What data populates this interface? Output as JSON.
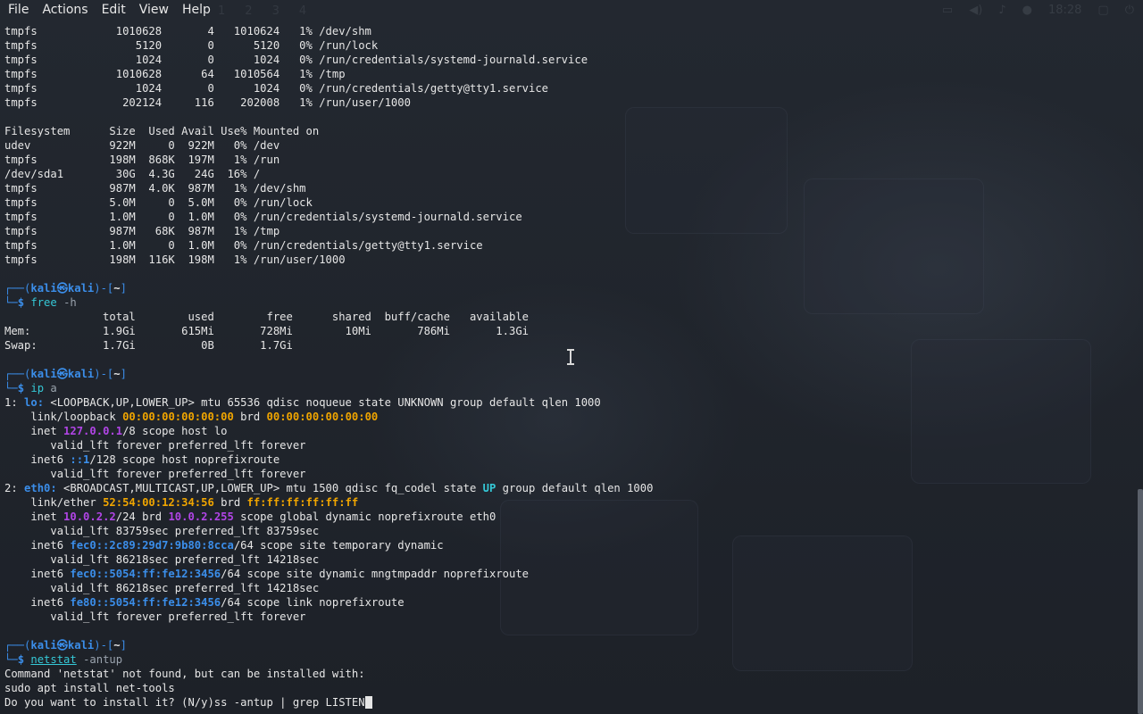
{
  "menubar": {
    "items": [
      "File",
      "Actions",
      "Edit",
      "View",
      "Help"
    ]
  },
  "panel": {
    "workspaces": [
      "1",
      "2",
      "3",
      "4"
    ],
    "clock": "18:28"
  },
  "lines": [
    [
      {
        "t": "tmpfs            1010628       4   1010624   1% /dev/shm"
      }
    ],
    [
      {
        "t": "tmpfs               5120       0      5120   0% /run/lock"
      }
    ],
    [
      {
        "t": "tmpfs               1024       0      1024   0% /run/credentials/systemd-journald.service"
      }
    ],
    [
      {
        "t": "tmpfs            1010628      64   1010564   1% /tmp"
      }
    ],
    [
      {
        "t": "tmpfs               1024       0      1024   0% /run/credentials/getty@tty1.service"
      }
    ],
    [
      {
        "t": "tmpfs             202124     116    202008   1% /run/user/1000"
      }
    ],
    [
      {
        "t": ""
      }
    ],
    [
      {
        "t": "Filesystem      Size  Used Avail Use% Mounted on"
      }
    ],
    [
      {
        "t": "udev            922M     0  922M   0% /dev"
      }
    ],
    [
      {
        "t": "tmpfs           198M  868K  197M   1% /run"
      }
    ],
    [
      {
        "t": "/dev/sda1        30G  4.3G   24G  16% /"
      }
    ],
    [
      {
        "t": "tmpfs           987M  4.0K  987M   1% /dev/shm"
      }
    ],
    [
      {
        "t": "tmpfs           5.0M     0  5.0M   0% /run/lock"
      }
    ],
    [
      {
        "t": "tmpfs           1.0M     0  1.0M   0% /run/credentials/systemd-journald.service"
      }
    ],
    [
      {
        "t": "tmpfs           987M   68K  987M   1% /tmp"
      }
    ],
    [
      {
        "t": "tmpfs           1.0M     0  1.0M   0% /run/credentials/getty@tty1.service"
      }
    ],
    [
      {
        "t": "tmpfs           198M  116K  198M   1% /run/user/1000"
      }
    ],
    [
      {
        "t": ""
      }
    ],
    [
      {
        "t": "┌──(",
        "c": "prompt-frame"
      },
      {
        "t": "kali㉿kali",
        "c": "prompt-user"
      },
      {
        "t": ")-[",
        "c": "prompt-frame"
      },
      {
        "t": "~",
        "c": "prompt-dir"
      },
      {
        "t": "]",
        "c": "prompt-frame"
      }
    ],
    [
      {
        "t": "└─",
        "c": "prompt-frame"
      },
      {
        "t": "$ ",
        "c": "prompt-user"
      },
      {
        "t": "free",
        "c": "cmd"
      },
      {
        "t": " -h",
        "c": "cmd-args"
      }
    ],
    [
      {
        "t": "               total        used        free      shared  buff/cache   available"
      }
    ],
    [
      {
        "t": "Mem:           1.9Gi       615Mi       728Mi        10Mi       786Mi       1.3Gi"
      }
    ],
    [
      {
        "t": "Swap:          1.7Gi          0B       1.7Gi"
      }
    ],
    [
      {
        "t": ""
      }
    ],
    [
      {
        "t": "┌──(",
        "c": "prompt-frame"
      },
      {
        "t": "kali㉿kali",
        "c": "prompt-user"
      },
      {
        "t": ")-[",
        "c": "prompt-frame"
      },
      {
        "t": "~",
        "c": "prompt-dir"
      },
      {
        "t": "]",
        "c": "prompt-frame"
      }
    ],
    [
      {
        "t": "└─",
        "c": "prompt-frame"
      },
      {
        "t": "$ ",
        "c": "prompt-user"
      },
      {
        "t": "ip",
        "c": "cmd"
      },
      {
        "t": " a",
        "c": "cmd-args"
      }
    ],
    [
      {
        "t": "1: "
      },
      {
        "t": "lo:",
        "c": "iface"
      },
      {
        "t": " <LOOPBACK,UP,LOWER_UP> mtu 65536 qdisc noqueue state UNKNOWN group default qlen 1000"
      }
    ],
    [
      {
        "t": "    link/loopback "
      },
      {
        "t": "00:00:00:00:00:00",
        "c": "mac"
      },
      {
        "t": " brd "
      },
      {
        "t": "00:00:00:00:00:00",
        "c": "mac"
      }
    ],
    [
      {
        "t": "    inet "
      },
      {
        "t": "127.0.0.1",
        "c": "ipv4"
      },
      {
        "t": "/8 scope host lo"
      }
    ],
    [
      {
        "t": "       valid_lft forever preferred_lft forever"
      }
    ],
    [
      {
        "t": "    inet6 "
      },
      {
        "t": "::1",
        "c": "ipv6"
      },
      {
        "t": "/128 scope host noprefixroute"
      }
    ],
    [
      {
        "t": "       valid_lft forever preferred_lft forever"
      }
    ],
    [
      {
        "t": "2: "
      },
      {
        "t": "eth0:",
        "c": "iface"
      },
      {
        "t": " <BROADCAST,MULTICAST,UP,LOWER_UP> mtu 1500 qdisc fq_codel state "
      },
      {
        "t": "UP",
        "c": "up"
      },
      {
        "t": " group default qlen 1000"
      }
    ],
    [
      {
        "t": "    link/ether "
      },
      {
        "t": "52:54:00:12:34:56",
        "c": "mac"
      },
      {
        "t": " brd "
      },
      {
        "t": "ff:ff:ff:ff:ff:ff",
        "c": "mac"
      }
    ],
    [
      {
        "t": "    inet "
      },
      {
        "t": "10.0.2.2",
        "c": "ipv4"
      },
      {
        "t": "/24 brd "
      },
      {
        "t": "10.0.2.255",
        "c": "ipv4"
      },
      {
        "t": " scope global dynamic noprefixroute eth0"
      }
    ],
    [
      {
        "t": "       valid_lft 83759sec preferred_lft 83759sec"
      }
    ],
    [
      {
        "t": "    inet6 "
      },
      {
        "t": "fec0::2c89:29d7:9b80:8cca",
        "c": "ipv6"
      },
      {
        "t": "/64 scope site temporary dynamic"
      }
    ],
    [
      {
        "t": "       valid_lft 86218sec preferred_lft 14218sec"
      }
    ],
    [
      {
        "t": "    inet6 "
      },
      {
        "t": "fec0::5054:ff:fe12:3456",
        "c": "ipv6"
      },
      {
        "t": "/64 scope site dynamic mngtmpaddr noprefixroute"
      }
    ],
    [
      {
        "t": "       valid_lft 86218sec preferred_lft 14218sec"
      }
    ],
    [
      {
        "t": "    inet6 "
      },
      {
        "t": "fe80::5054:ff:fe12:3456",
        "c": "ipv6"
      },
      {
        "t": "/64 scope link noprefixroute"
      }
    ],
    [
      {
        "t": "       valid_lft forever preferred_lft forever"
      }
    ],
    [
      {
        "t": ""
      }
    ],
    [
      {
        "t": "┌──(",
        "c": "prompt-frame"
      },
      {
        "t": "kali㉿kali",
        "c": "prompt-user"
      },
      {
        "t": ")-[",
        "c": "prompt-frame"
      },
      {
        "t": "~",
        "c": "prompt-dir"
      },
      {
        "t": "]",
        "c": "prompt-frame"
      }
    ],
    [
      {
        "t": "└─",
        "c": "prompt-frame"
      },
      {
        "t": "$ ",
        "c": "prompt-user"
      },
      {
        "t": "netstat",
        "c": "cmd underline"
      },
      {
        "t": " -antup",
        "c": "cmd-args"
      }
    ],
    [
      {
        "t": "Command 'netstat' not found, but can be installed with:"
      }
    ],
    [
      {
        "t": "sudo apt install net-tools"
      }
    ],
    [
      {
        "t": "Do you want to install it? (N/y)ss -antup | grep LISTEN"
      },
      {
        "t": "",
        "c": "cursor"
      }
    ]
  ],
  "colors": {
    "prompt": "#3b8eea",
    "command": "#35c8d6",
    "mac": "#f0a500",
    "ipv4": "#b145e6",
    "ipv6": "#3b8eea",
    "text": "#e6e6e6"
  }
}
